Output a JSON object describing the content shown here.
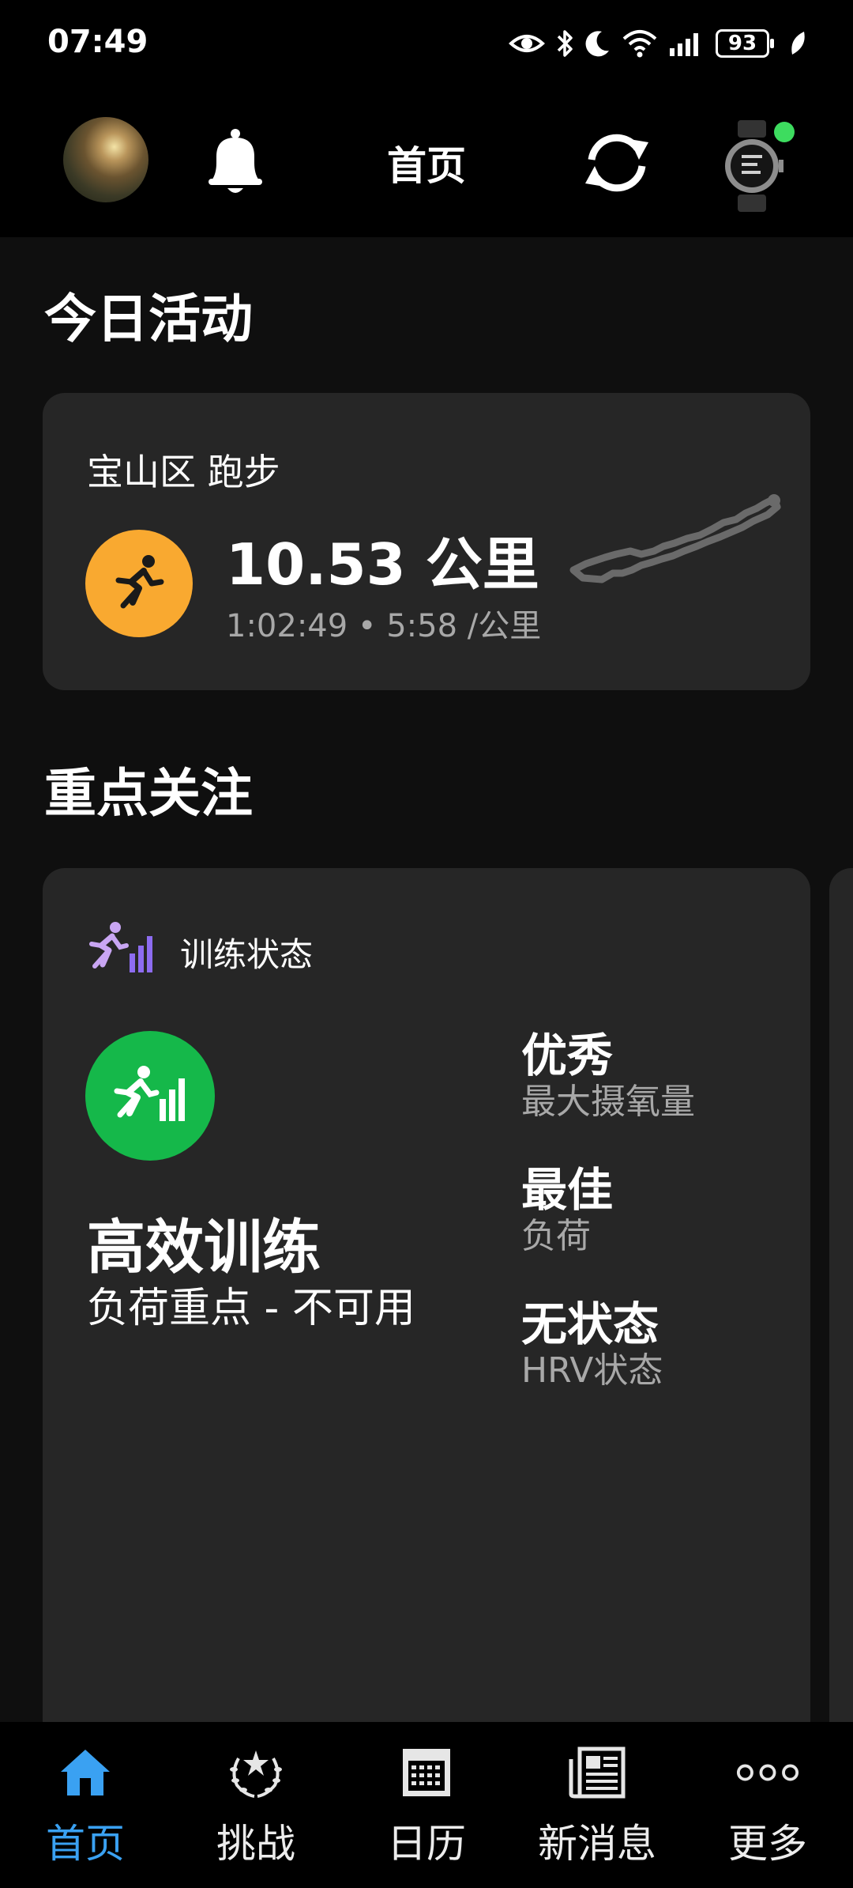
{
  "status_bar": {
    "time": "07:49",
    "battery": "93"
  },
  "header": {
    "title": "首页"
  },
  "today": {
    "section_title": "今日活动",
    "activity": {
      "location": "宝山区 跑步",
      "distance": "10.53 公里",
      "stats": "1:02:49 • 5:58 /公里",
      "accent_color": "#f9a930"
    }
  },
  "focus": {
    "section_title": "重点关注",
    "card_title": "训练状态",
    "status": "高效训练",
    "status_sub": "负荷重点 - 不可用",
    "status_color": "#15b84a",
    "metrics": [
      {
        "value": "优秀",
        "label": "最大摄氧量"
      },
      {
        "value": "最佳",
        "label": "负荷"
      },
      {
        "value": "无状态",
        "label": "HRV状态"
      }
    ]
  },
  "nav": {
    "active_color": "#3aa1f2",
    "items": [
      {
        "label": "首页",
        "icon": "home-icon",
        "active": true
      },
      {
        "label": "挑战",
        "icon": "laurel-icon"
      },
      {
        "label": "日历",
        "icon": "calendar-icon"
      },
      {
        "label": "新消息",
        "icon": "news-icon"
      },
      {
        "label": "更多",
        "icon": "more-icon"
      }
    ]
  }
}
